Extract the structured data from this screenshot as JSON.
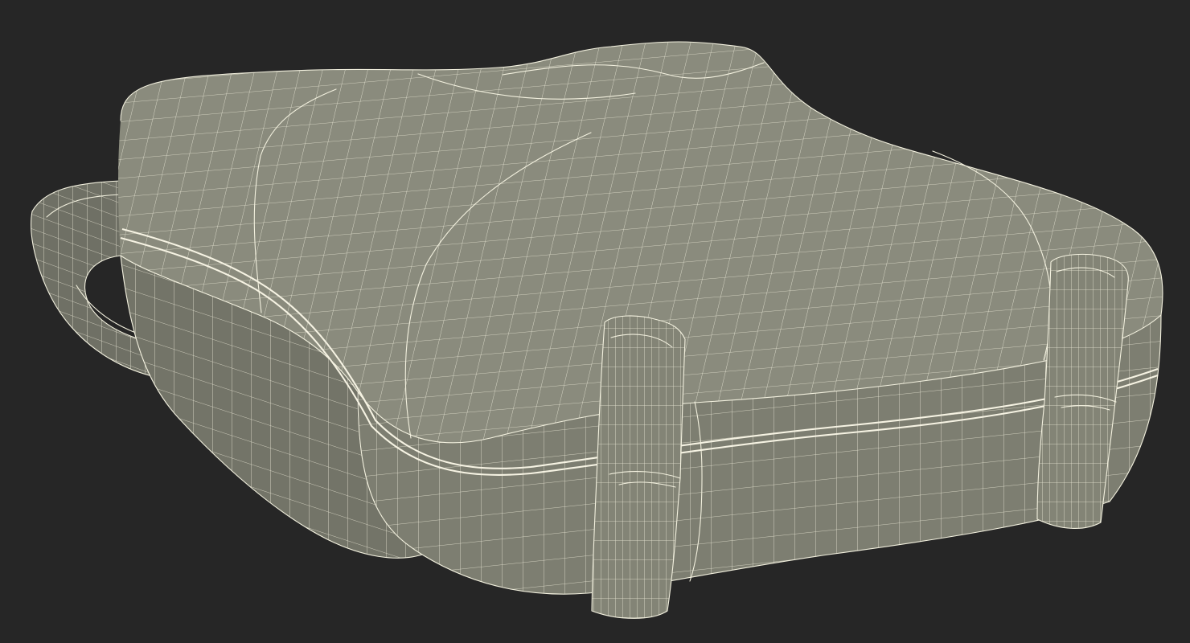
{
  "scene": {
    "background_color": "#262626",
    "model_color": "#7f8073",
    "wire_color": "#f3f1df",
    "render_style": "wireframe-overlay"
  },
  "objects": [
    {
      "name": "case-shell"
    },
    {
      "name": "carry-handle"
    },
    {
      "name": "left-latch"
    },
    {
      "name": "right-latch"
    }
  ]
}
